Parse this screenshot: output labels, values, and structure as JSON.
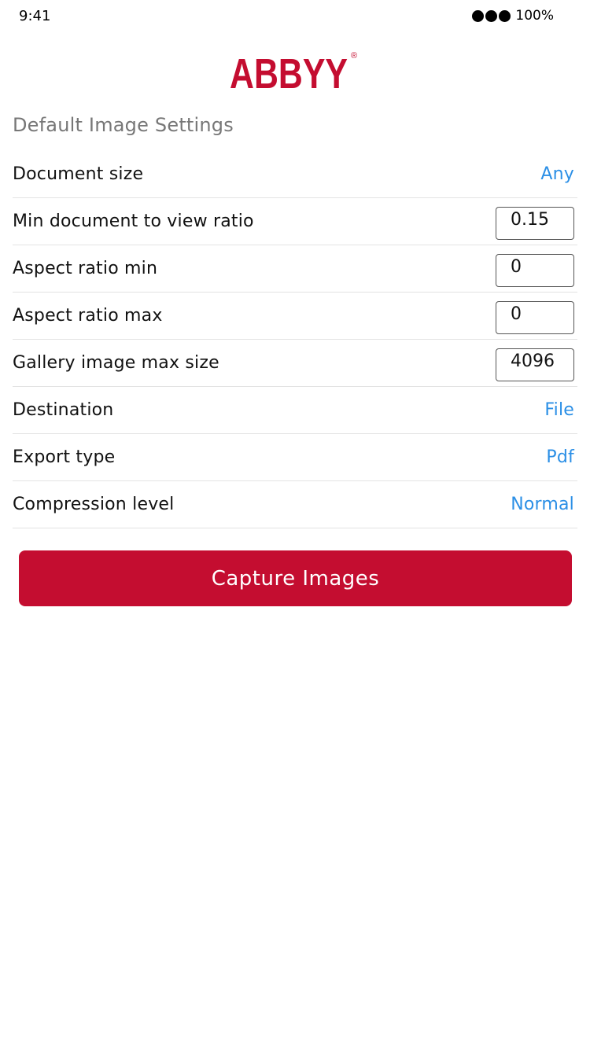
{
  "status_bar": {
    "time": "9:41",
    "battery": "100%",
    "signal_icon": "signal-dots-icon"
  },
  "logo": {
    "text": "ABBYY",
    "mark": "®",
    "color": "#c40d30"
  },
  "section": {
    "title": "Default Image Settings"
  },
  "settings": {
    "document_size": {
      "label": "Document size",
      "value": "Any"
    },
    "min_ratio": {
      "label": "Min document to view ratio",
      "value": "0.15"
    },
    "aspect_min": {
      "label": "Aspect ratio min",
      "value": "0"
    },
    "aspect_max": {
      "label": "Aspect ratio max",
      "value": "0"
    },
    "gallery_max": {
      "label": "Gallery image max size",
      "value": "4096"
    },
    "destination": {
      "label": "Destination",
      "value": "File"
    },
    "export_type": {
      "label": "Export type",
      "value": "Pdf"
    },
    "compression": {
      "label": "Compression level",
      "value": "Normal"
    }
  },
  "actions": {
    "capture_label": "Capture Images"
  },
  "colors": {
    "accent_link": "#2b8fe6",
    "brand_red": "#c40d30",
    "section_gray": "#777777"
  }
}
